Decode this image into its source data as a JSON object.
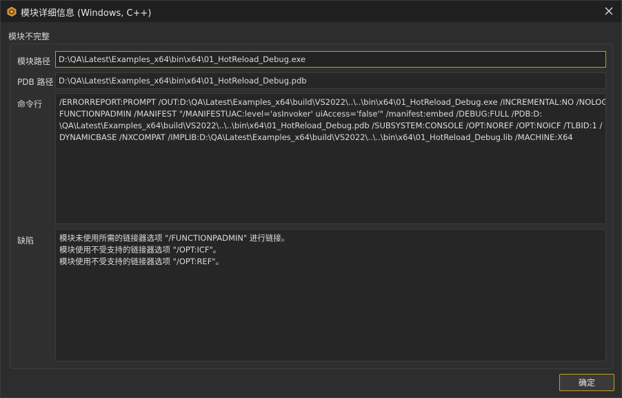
{
  "window": {
    "title": "模块详细信息 (Windows, C++)",
    "app_icon": "hexagon-logo-icon",
    "close_icon": "close-icon"
  },
  "group": {
    "title": "模块不完整"
  },
  "fields": {
    "module_path": {
      "label": "模块路径",
      "value": "D:\\QA\\Latest\\Examples_x64\\bin\\x64\\01_HotReload_Debug.exe"
    },
    "pdb_path": {
      "label": "PDB 路径",
      "value": "D:\\QA\\Latest\\Examples_x64\\bin\\x64\\01_HotReload_Debug.pdb"
    },
    "command": {
      "label": "命令行",
      "lines": [
        " /ERRORREPORT:PROMPT /OUT:D:\\QA\\Latest\\Examples_x64\\build\\VS2022\\..\\..\\bin\\x64\\01_HotReload_Debug.exe /INCREMENTAL:NO /NOLOGO /",
        "FUNCTIONPADMIN /MANIFEST \"/MANIFESTUAC:level='asInvoker' uiAccess='false'\" /manifest:embed /DEBUG:FULL /PDB:D:",
        "\\QA\\Latest\\Examples_x64\\build\\VS2022\\..\\..\\bin\\x64\\01_HotReload_Debug.pdb /SUBSYSTEM:CONSOLE /OPT:NOREF /OPT:NOICF /TLBID:1 /",
        "DYNAMICBASE /NXCOMPAT /IMPLIB:D:\\QA\\Latest\\Examples_x64\\build\\VS2022\\..\\..\\bin\\x64\\01_HotReload_Debug.lib /MACHINE:X64"
      ]
    },
    "defects": {
      "label": "缺陷",
      "lines": [
        "模块未使用所需的链接器选项 \"/FUNCTIONPADMIN\" 进行链接。",
        "模块使用不受支持的链接器选项 \"/OPT:ICF\"。",
        "模块使用不受支持的链接器选项 \"/OPT:REF\"。"
      ]
    }
  },
  "buttons": {
    "ok_label": "确定"
  },
  "colors": {
    "accent": "#c99a2e",
    "background": "#2d2d2d",
    "titlebar": "#202020"
  }
}
